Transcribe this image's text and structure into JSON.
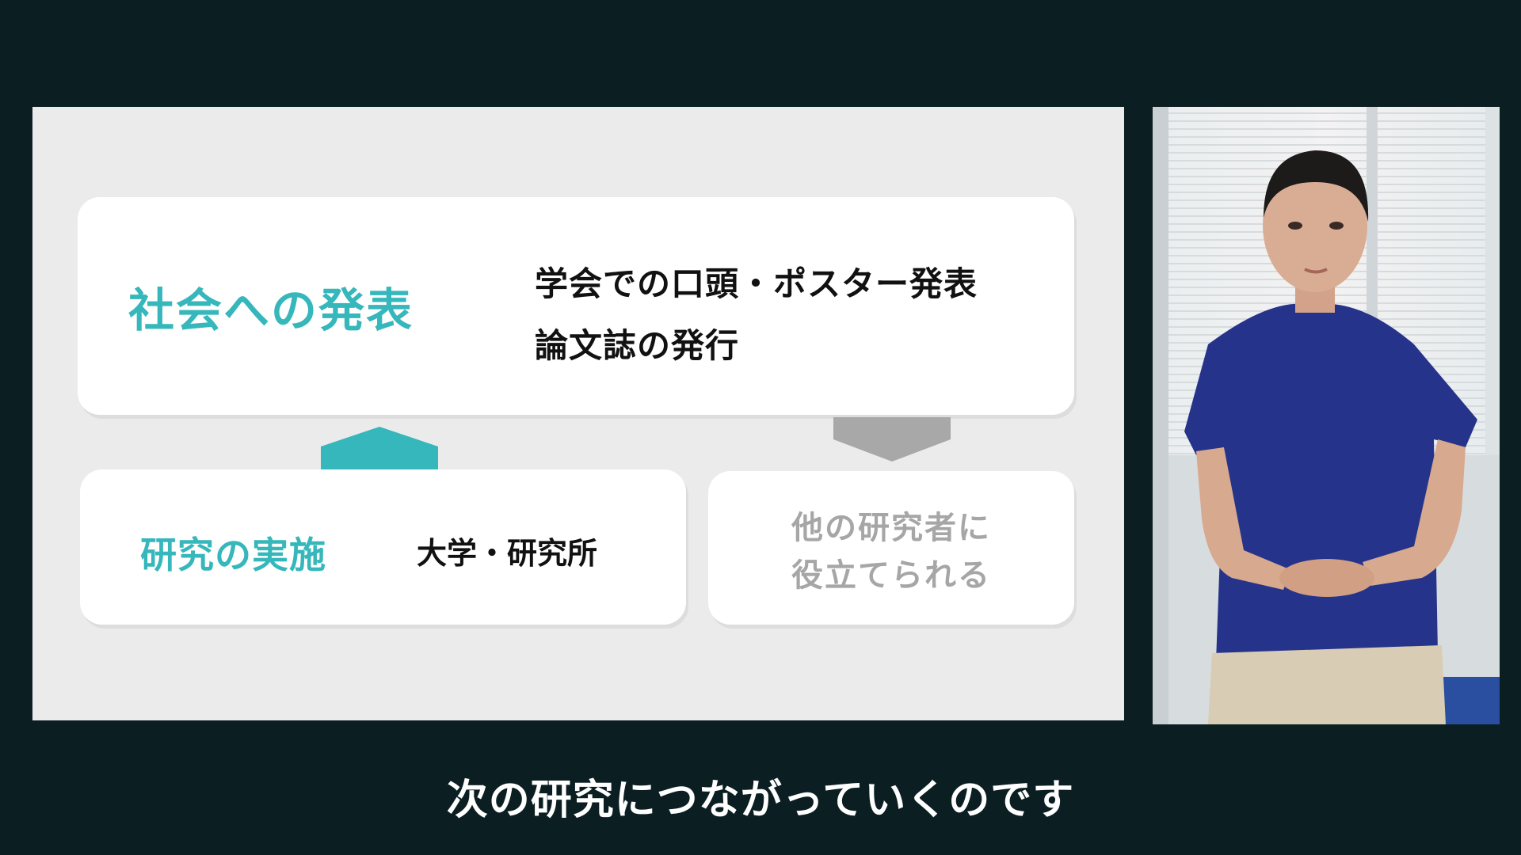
{
  "slide": {
    "top_card": {
      "heading": "社会への発表",
      "lines": [
        "学会での口頭・ポスター発表",
        "論文誌の発行"
      ]
    },
    "bottom_left_card": {
      "heading": "研究の実施",
      "detail": "大学・研究所"
    },
    "bottom_right_card": {
      "lines": [
        "他の研究者に",
        "役立てられる"
      ]
    }
  },
  "subtitle": "次の研究につながっていくのです",
  "colors": {
    "background": "#0b1e22",
    "slide_bg": "#ebebeb",
    "accent_teal": "#36b7bb",
    "muted_gray": "#a6a6a6"
  },
  "icons": {
    "arrow_up": "arrow-up-icon",
    "arrow_down": "arrow-down-icon"
  }
}
